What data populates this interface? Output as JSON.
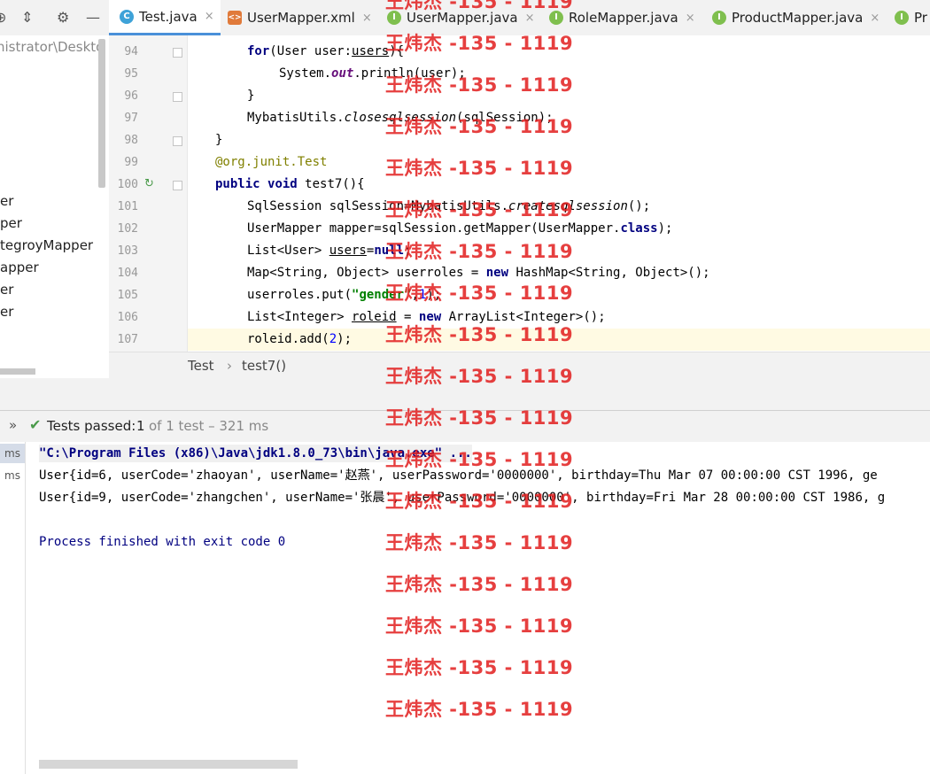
{
  "toolbar": {
    "icons": [
      "globe-icon",
      "collapse-icon",
      "gear-icon",
      "minimize-icon"
    ]
  },
  "tabs": [
    {
      "label": "Test.java",
      "icon": "class-icon",
      "active": true,
      "close": "×"
    },
    {
      "label": "UserMapper.xml",
      "icon": "xml-icon",
      "active": false,
      "close": "×"
    },
    {
      "label": "UserMapper.java",
      "icon": "interface-icon",
      "active": false,
      "close": "×"
    },
    {
      "label": "RoleMapper.java",
      "icon": "interface-icon",
      "active": false,
      "close": "×"
    },
    {
      "label": "ProductMapper.java",
      "icon": "interface-icon",
      "active": false,
      "close": "×"
    },
    {
      "label": "Pr",
      "icon": "interface-icon",
      "active": false,
      "close": ""
    }
  ],
  "tree": {
    "path": "nistrator\\Deskto",
    "items": [
      "er",
      "per",
      "tegroyMapper",
      "apper",
      "er",
      "er"
    ]
  },
  "editor": {
    "line_numbers": [
      "94",
      "95",
      "96",
      "97",
      "98",
      "99",
      "100",
      "101",
      "102",
      "103",
      "104",
      "105",
      "106",
      "107"
    ],
    "lines": [
      "for(User user:users){",
      "System.out.println(user);",
      "}",
      "MybatisUtils.closesqlsession(sqlSession);",
      "}",
      "@org.junit.Test",
      "public void test7(){",
      "SqlSession sqlSession=MybatisUtils.createsqlsession();",
      "UserMapper mapper=sqlSession.getMapper(UserMapper.class);",
      "List<User> users=null;",
      "Map<String, Object> userroles = new HashMap<String, Object>();",
      "userroles.put(\"gender\",1);",
      "List<Integer> roleid = new ArrayList<Integer>();",
      "roleid.add(2);"
    ],
    "tokens": {
      "for": "for",
      "user_type": "User",
      "user_var": "user",
      "users": "users",
      "system": "System.",
      "out": "out",
      "println": ".println(user);",
      "close_brace": "}",
      "mybatis_utils": "MybatisUtils.",
      "closesqlsession": "closesqlsession",
      "close_args": "(sqlSession);",
      "annotation_pkg": "@org.junit.",
      "annotation_name": "Test",
      "public": "public",
      "void": "void",
      "test7": "test7(){",
      "sqlsession_decl": "SqlSession sqlSession=MybatisUtils.",
      "createsqlsession": "createsqlsession",
      "create_args": "();",
      "mapper_decl": "UserMapper mapper=sqlSession.getMapper(UserMapper.",
      "class_kw": "class",
      "mapper_end": ");",
      "list_user": "List<User> ",
      "null_kw": "null",
      "semi": ";",
      "map_decl": "Map<String, Object> userroles = ",
      "new_kw": "new",
      "hashmap": " HashMap<String, Object>();",
      "put_start": "userroles.put(",
      "gender_str": "\"gender\"",
      "comma": ",",
      "one": "1",
      "put_end": ");",
      "list_integer": "List<Integer> ",
      "roleid": "roleid",
      "eq": " = ",
      "arraylist": " ArrayList<Integer>();",
      "roleid_add": "roleid.add(",
      "two": "2",
      "add_end": ");"
    }
  },
  "breadcrumb": {
    "items": [
      "Test",
      "test7()"
    ],
    "separator": "›"
  },
  "run": {
    "status_icon": "check-icon",
    "status_label": "Tests passed:",
    "passed_count": "1",
    "status_detail": "of 1 test – 321 ms",
    "left_items": [
      "ms",
      "ms"
    ],
    "console": [
      "\"C:\\Program Files (x86)\\Java\\jdk1.8.0_73\\bin\\java.exe\" ...",
      "User{id=6, userCode='zhaoyan', userName='赵燕', userPassword='0000000', birthday=Thu Mar 07 00:00:00 CST 1996, ge",
      "User{id=9, userCode='zhangchen', userName='张晨', userPassword='0000000', birthday=Fri Mar 28 00:00:00 CST 1986, g",
      "",
      "Process finished with exit code 0"
    ]
  },
  "watermark": {
    "text": "王炜杰 -135 - 1119",
    "color": "#e21e1e",
    "count": 18
  }
}
